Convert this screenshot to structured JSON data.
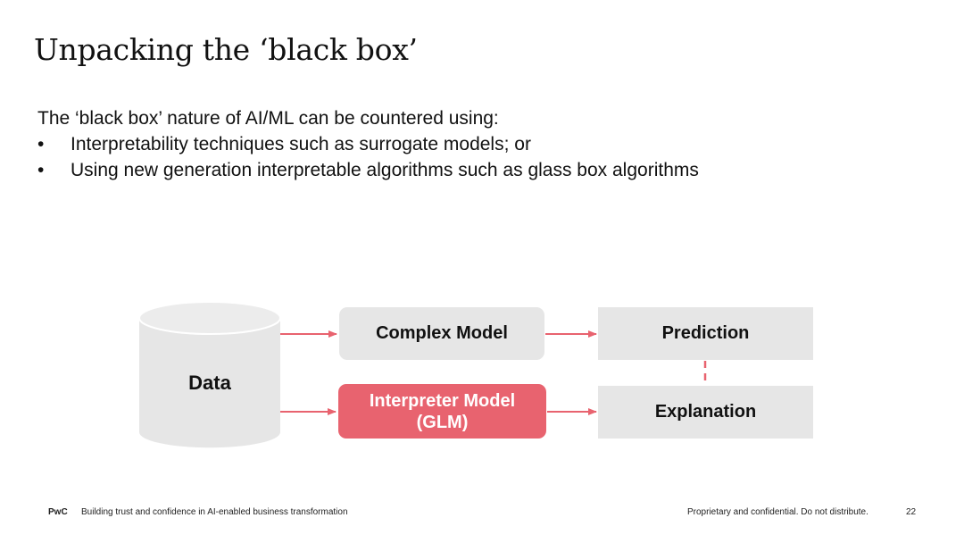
{
  "slide": {
    "title": "Unpacking the ‘black box’",
    "intro": "The ‘black box’ nature of AI/ML can be countered using:",
    "bullet_char": "•",
    "bullets": [
      "Interpretability techniques such as surrogate models; or",
      "Using new generation interpretable algorithms such as glass box algorithms"
    ]
  },
  "diagram": {
    "data_label": "Data",
    "complex_model": "Complex Model",
    "interpreter_model_line1": "Interpreter Model",
    "interpreter_model_line2": "(GLM)",
    "prediction": "Prediction",
    "explanation": "Explanation"
  },
  "colors": {
    "accent": "#e8636f",
    "box_fill": "#e6e6e6",
    "arrow": "#e8636f"
  },
  "footer": {
    "brand": "PwC",
    "tagline": "Building trust and confidence in AI-enabled business transformation",
    "confidential": "Proprietary and confidential. Do not distribute.",
    "page_number": "22"
  }
}
